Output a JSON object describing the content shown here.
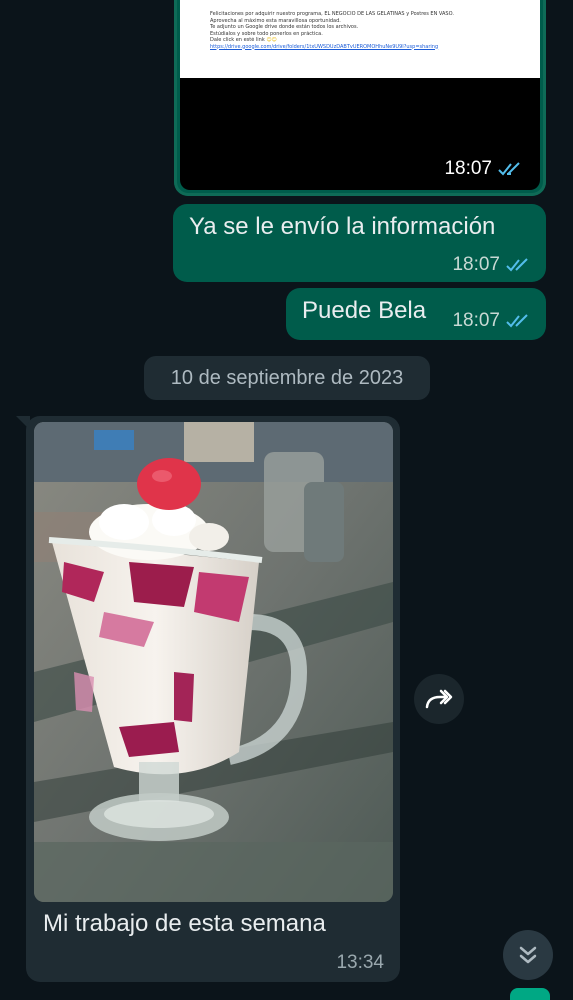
{
  "messages": {
    "doc_image": {
      "time": "18:07",
      "doc_lines": [
        "Felicitaciones por adquirir nuestro programa, EL NEGOCIO DE LAS GELATINAS y Postres EN VASO.",
        "",
        "Aprovecha al máximo esta maravillosa oportunidad.",
        "",
        "Te adjunto un Google drive donde están todos los archivos.",
        "Estúdialos y sobre todo ponerlos en práctica.",
        "Dale click en esté link"
      ],
      "doc_link": "https://drive.google.com/drive/folders/1txUWSDUzDABTvUEROMOHhuNe9U9I?usp=sharing"
    },
    "text1": {
      "text": "Ya se le envío la información",
      "time": "18:07"
    },
    "text2": {
      "text": "Puede Bela",
      "time": "18:07"
    },
    "date_separator": "10 de septiembre de 2023",
    "incoming_photo": {
      "caption": "Mi trabajo de esta semana",
      "time": "13:34"
    }
  },
  "icons": {
    "read_receipt": "double-check-icon",
    "forward": "forward-icon",
    "scroll_down": "double-chevron-down-icon"
  },
  "colors": {
    "background": "#0b141a",
    "outgoing_bubble": "#005c4b",
    "incoming_bubble": "#1f2c33",
    "read_tick": "#53bdeb",
    "accent": "#00a884"
  }
}
